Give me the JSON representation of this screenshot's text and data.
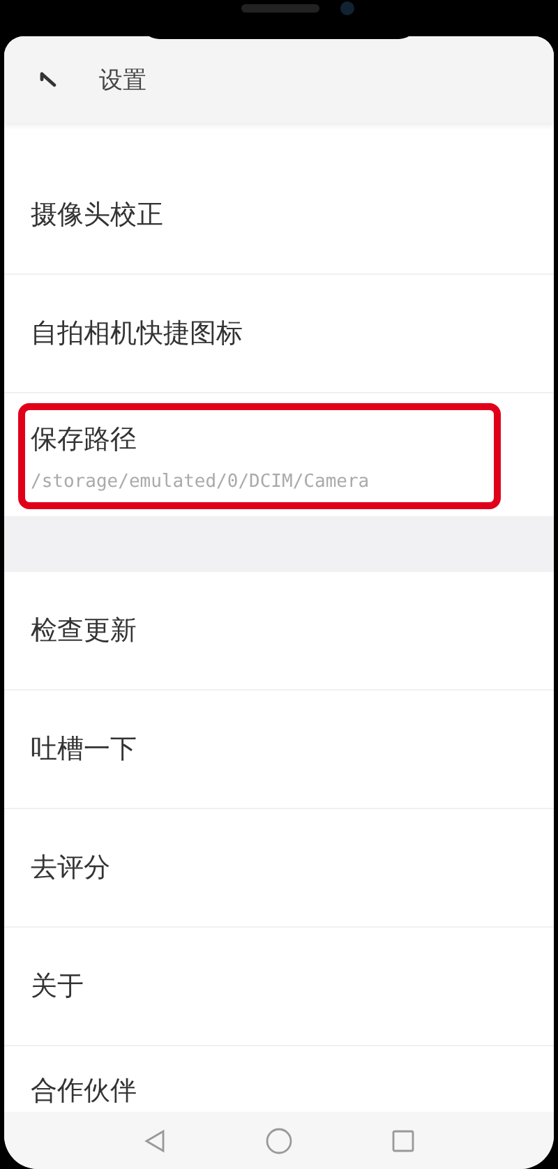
{
  "header": {
    "title": "设置"
  },
  "sections": [
    {
      "items": [
        {
          "label": "摄像头校正",
          "highlighted": false
        },
        {
          "label": "自拍相机快捷图标",
          "highlighted": false
        },
        {
          "label": "保存路径",
          "value": "/storage/emulated/0/DCIM/Camera",
          "highlighted": true
        }
      ]
    },
    {
      "items": [
        {
          "label": "检查更新",
          "highlighted": false
        },
        {
          "label": "吐槽一下",
          "highlighted": false
        },
        {
          "label": "去评分",
          "highlighted": false
        },
        {
          "label": "关于",
          "highlighted": false
        },
        {
          "label": "合作伙伴",
          "highlighted": false
        }
      ]
    }
  ]
}
